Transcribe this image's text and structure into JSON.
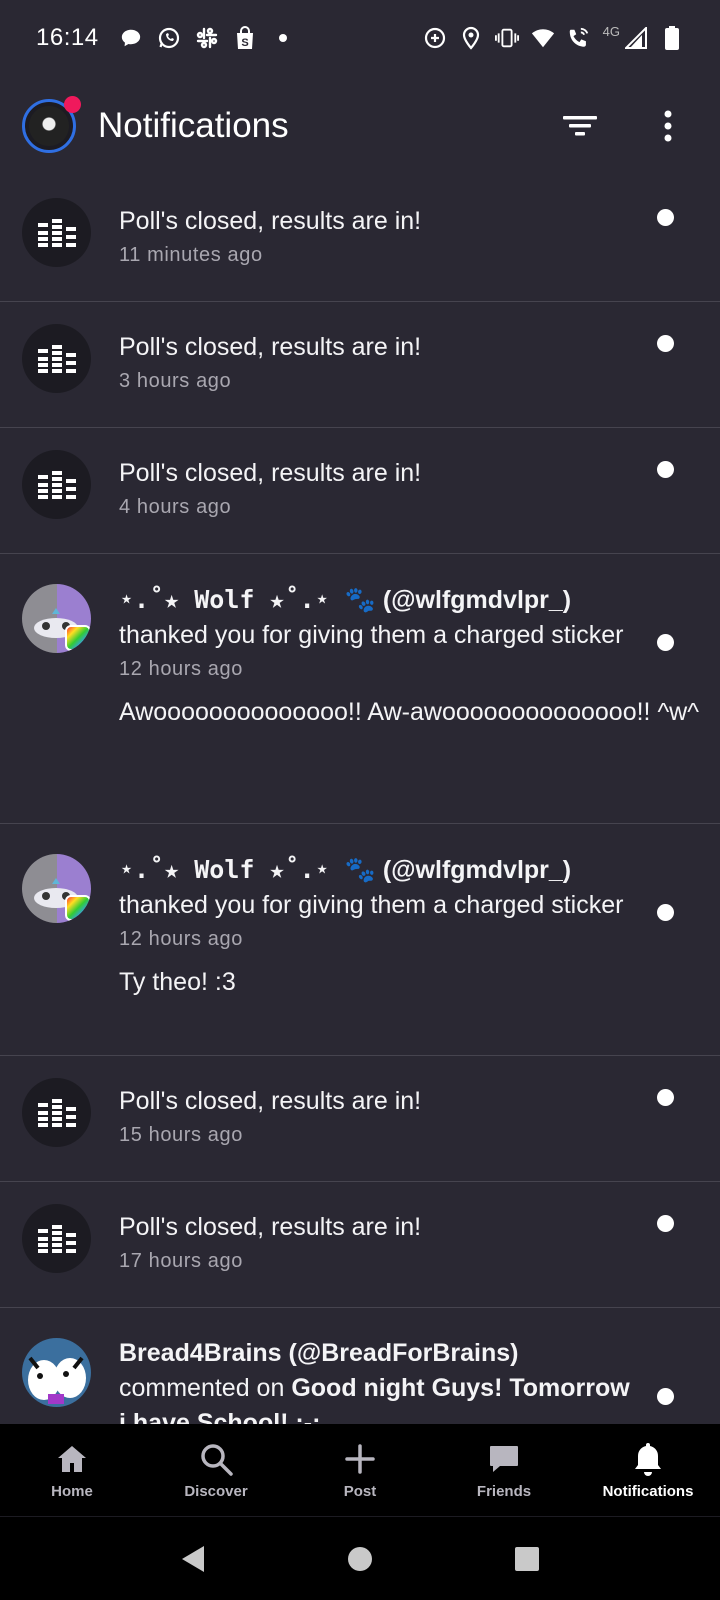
{
  "status_bar": {
    "time": "16:14",
    "left_icons": [
      "chat-bubble-icon",
      "whatsapp-icon",
      "slack-icon",
      "shopping-bag-icon",
      "dot-icon"
    ],
    "right_icons": [
      "data-saver-icon",
      "location-icon",
      "vibrate-icon",
      "wifi-icon",
      "wifi-calling-icon",
      "signal-icon",
      "battery-icon"
    ],
    "network": "4G"
  },
  "header": {
    "title": "Notifications",
    "filter_icon": "filter-icon",
    "more_icon": "more-vertical-icon"
  },
  "notifications": [
    {
      "type": "poll",
      "title": "Poll's closed, results are in!",
      "time": "11 minutes ago",
      "unread": true
    },
    {
      "type": "poll",
      "title": "Poll's closed, results are in!",
      "time": "3 hours ago",
      "unread": true
    },
    {
      "type": "poll",
      "title": "Poll's closed, results are in!",
      "time": "4 hours ago",
      "unread": true
    },
    {
      "type": "sticker",
      "user_display": "⋆.˚★ Wolf ★˚.⋆ 🐾",
      "handle": "(@wlfgmdvlpr_)",
      "action": "thanked you for giving them a charged sticker",
      "time": "12 hours ago",
      "message": "Awoooooooooooooo!! Aw-awoooooooooooooo!! ^w^",
      "unread": true
    },
    {
      "type": "sticker",
      "user_display": "⋆.˚★ Wolf ★˚.⋆ 🐾",
      "handle": "(@wlfgmdvlpr_)",
      "action": "thanked you for giving them a charged sticker",
      "time": "12 hours ago",
      "message": "Ty theo! :3",
      "unread": true
    },
    {
      "type": "poll",
      "title": "Poll's closed, results are in!",
      "time": "15 hours ago",
      "unread": true
    },
    {
      "type": "poll",
      "title": "Poll's closed, results are in!",
      "time": "17 hours ago",
      "unread": true
    },
    {
      "type": "comment",
      "user": "Bread4Brains (@BreadForBrains)",
      "action": "commented on",
      "post": "Good night Guys! Tomorrow i have School! :-:",
      "unread": true
    }
  ],
  "bottom_nav": [
    {
      "label": "Home",
      "icon": "home-icon"
    },
    {
      "label": "Discover",
      "icon": "search-icon"
    },
    {
      "label": "Post",
      "icon": "plus-icon"
    },
    {
      "label": "Friends",
      "icon": "chat-icon"
    },
    {
      "label": "Notifications",
      "icon": "bell-icon",
      "active": true
    }
  ],
  "colors": {
    "background": "#2a2833",
    "accent_dot": "#f0195c",
    "divider": "#46444f"
  }
}
